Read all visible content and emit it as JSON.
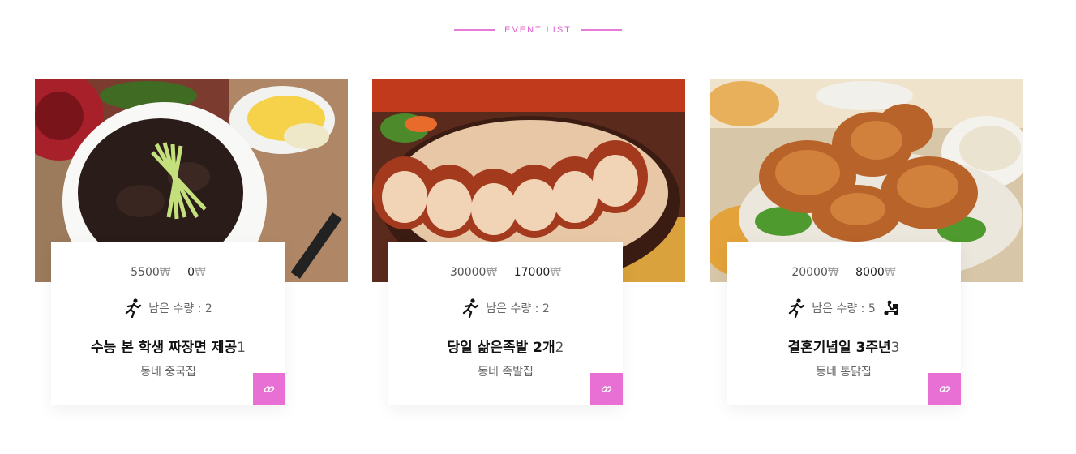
{
  "section": {
    "title": "EVENT LIST"
  },
  "colors": {
    "accent": "#e86fd3"
  },
  "events": [
    {
      "old_price": "5500",
      "new_price": "0",
      "currency": "₩",
      "remain_label": "남은 수량 : 2",
      "title": "수능 본 학생 짜장면 제공",
      "title_num": "1",
      "shop": "동네 중국집",
      "image": "jajangmyeon-photo",
      "delivery_icon": false
    },
    {
      "old_price": "30000",
      "new_price": "17000",
      "currency": "₩",
      "remain_label": "남은 수량 : 2",
      "title": "당일 삶은족발 2개",
      "title_num": "2",
      "shop": "동네 족발집",
      "image": "jokbal-photo",
      "delivery_icon": false
    },
    {
      "old_price": "20000",
      "new_price": "8000",
      "currency": "₩",
      "remain_label": "남은 수량 : 5",
      "title": "결혼기념일 3주년",
      "title_num": "3",
      "shop": "동네 통닭집",
      "image": "fried-chicken-photo",
      "delivery_icon": true
    }
  ]
}
